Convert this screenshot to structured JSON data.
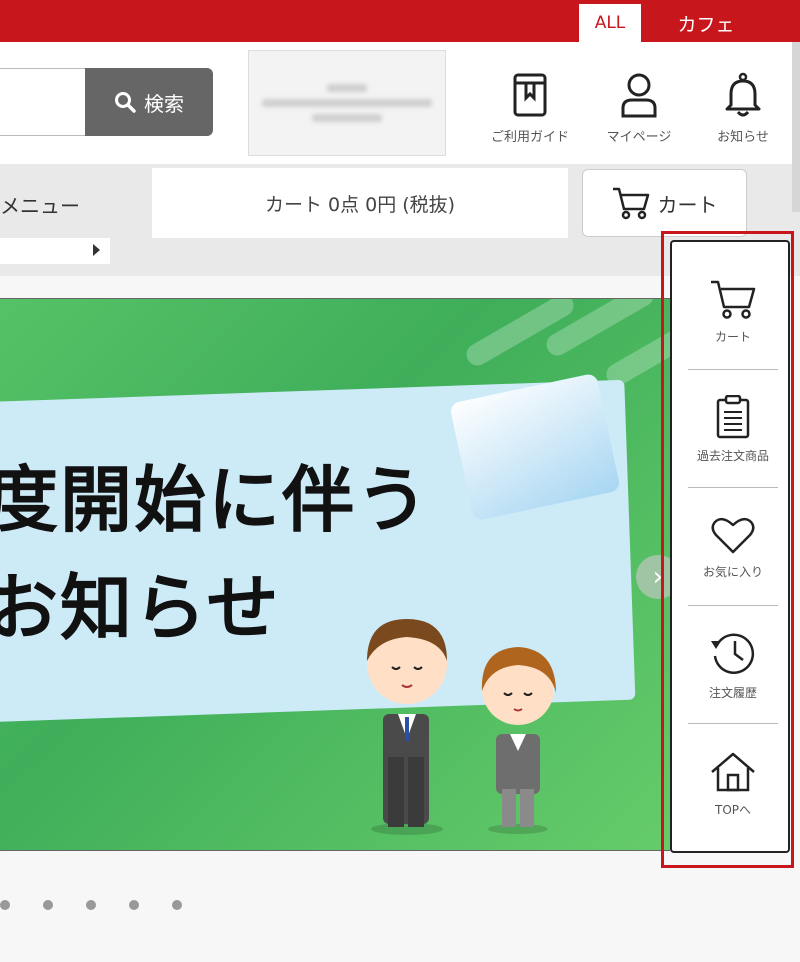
{
  "top_tabs": {
    "all": "ALL",
    "cafe": "カフェ"
  },
  "search": {
    "button_label": "検索",
    "value": ""
  },
  "header_icons": [
    {
      "label": "ご利用ガイド",
      "icon": "guide-book-icon"
    },
    {
      "label": "マイページ",
      "icon": "person-icon"
    },
    {
      "label": "お知らせ",
      "icon": "bell-icon"
    }
  ],
  "menu": {
    "label": "メニュー"
  },
  "cart_summary": "カート 0点 0円 (税抜)",
  "cart_button": "カート",
  "banner": {
    "line1": "度開始に伴う",
    "line2": "お知らせ",
    "slide_count": 5
  },
  "side_panel": [
    {
      "label": "カート",
      "icon": "cart-icon"
    },
    {
      "label": "過去注文商品",
      "icon": "clipboard-icon"
    },
    {
      "label": "お気に入り",
      "icon": "heart-icon"
    },
    {
      "label": "注文履歴",
      "icon": "history-clock-icon"
    },
    {
      "label": "TOPへ",
      "icon": "home-icon"
    }
  ],
  "colors": {
    "brand_red": "#c8161d",
    "banner_green": "#4dbb62",
    "button_grey": "#666666"
  }
}
